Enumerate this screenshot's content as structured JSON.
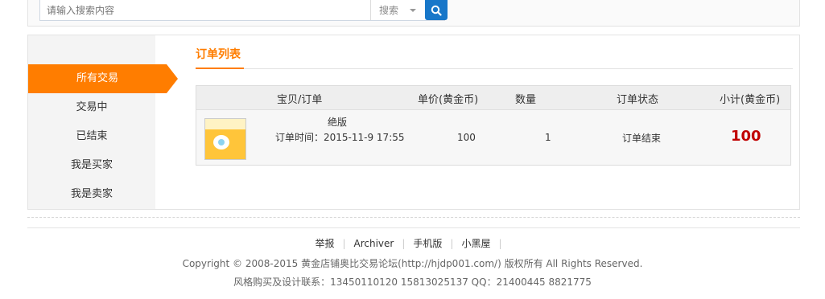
{
  "search": {
    "placeholder": "请输入搜索内容",
    "type_label": "搜索"
  },
  "sidebar": {
    "items": [
      {
        "label": "所有交易",
        "active": true
      },
      {
        "label": "交易中",
        "active": false
      },
      {
        "label": "已结束",
        "active": false
      },
      {
        "label": "我是买家",
        "active": false
      },
      {
        "label": "我是卖家",
        "active": false
      }
    ]
  },
  "main": {
    "tab_title": "订单列表",
    "columns": [
      "宝贝/订单",
      "单价(黄金币)",
      "数量",
      "订单状态",
      "小计(黄金币)"
    ],
    "order": {
      "item_name": "绝版",
      "order_time": "订单时间：2015-11-9 17:55",
      "price": "100",
      "quantity": "1",
      "status": "订单结束",
      "subtotal": "100"
    }
  },
  "footer": {
    "links": [
      "举报",
      "Archiver",
      "手机版",
      "小黑屋"
    ],
    "copyright": "Copyright © 2008-2015 黄金店铺奥比交易论坛(http://hjdp001.com/) 版权所有 All Rights Reserved.",
    "contact": "风格购买及设计联系：13450110120 15813025137 QQ：21400445 8821775"
  },
  "colors": {
    "accent": "#ff7d00",
    "search_button": "#1877c9",
    "subtotal": "#c00000"
  }
}
